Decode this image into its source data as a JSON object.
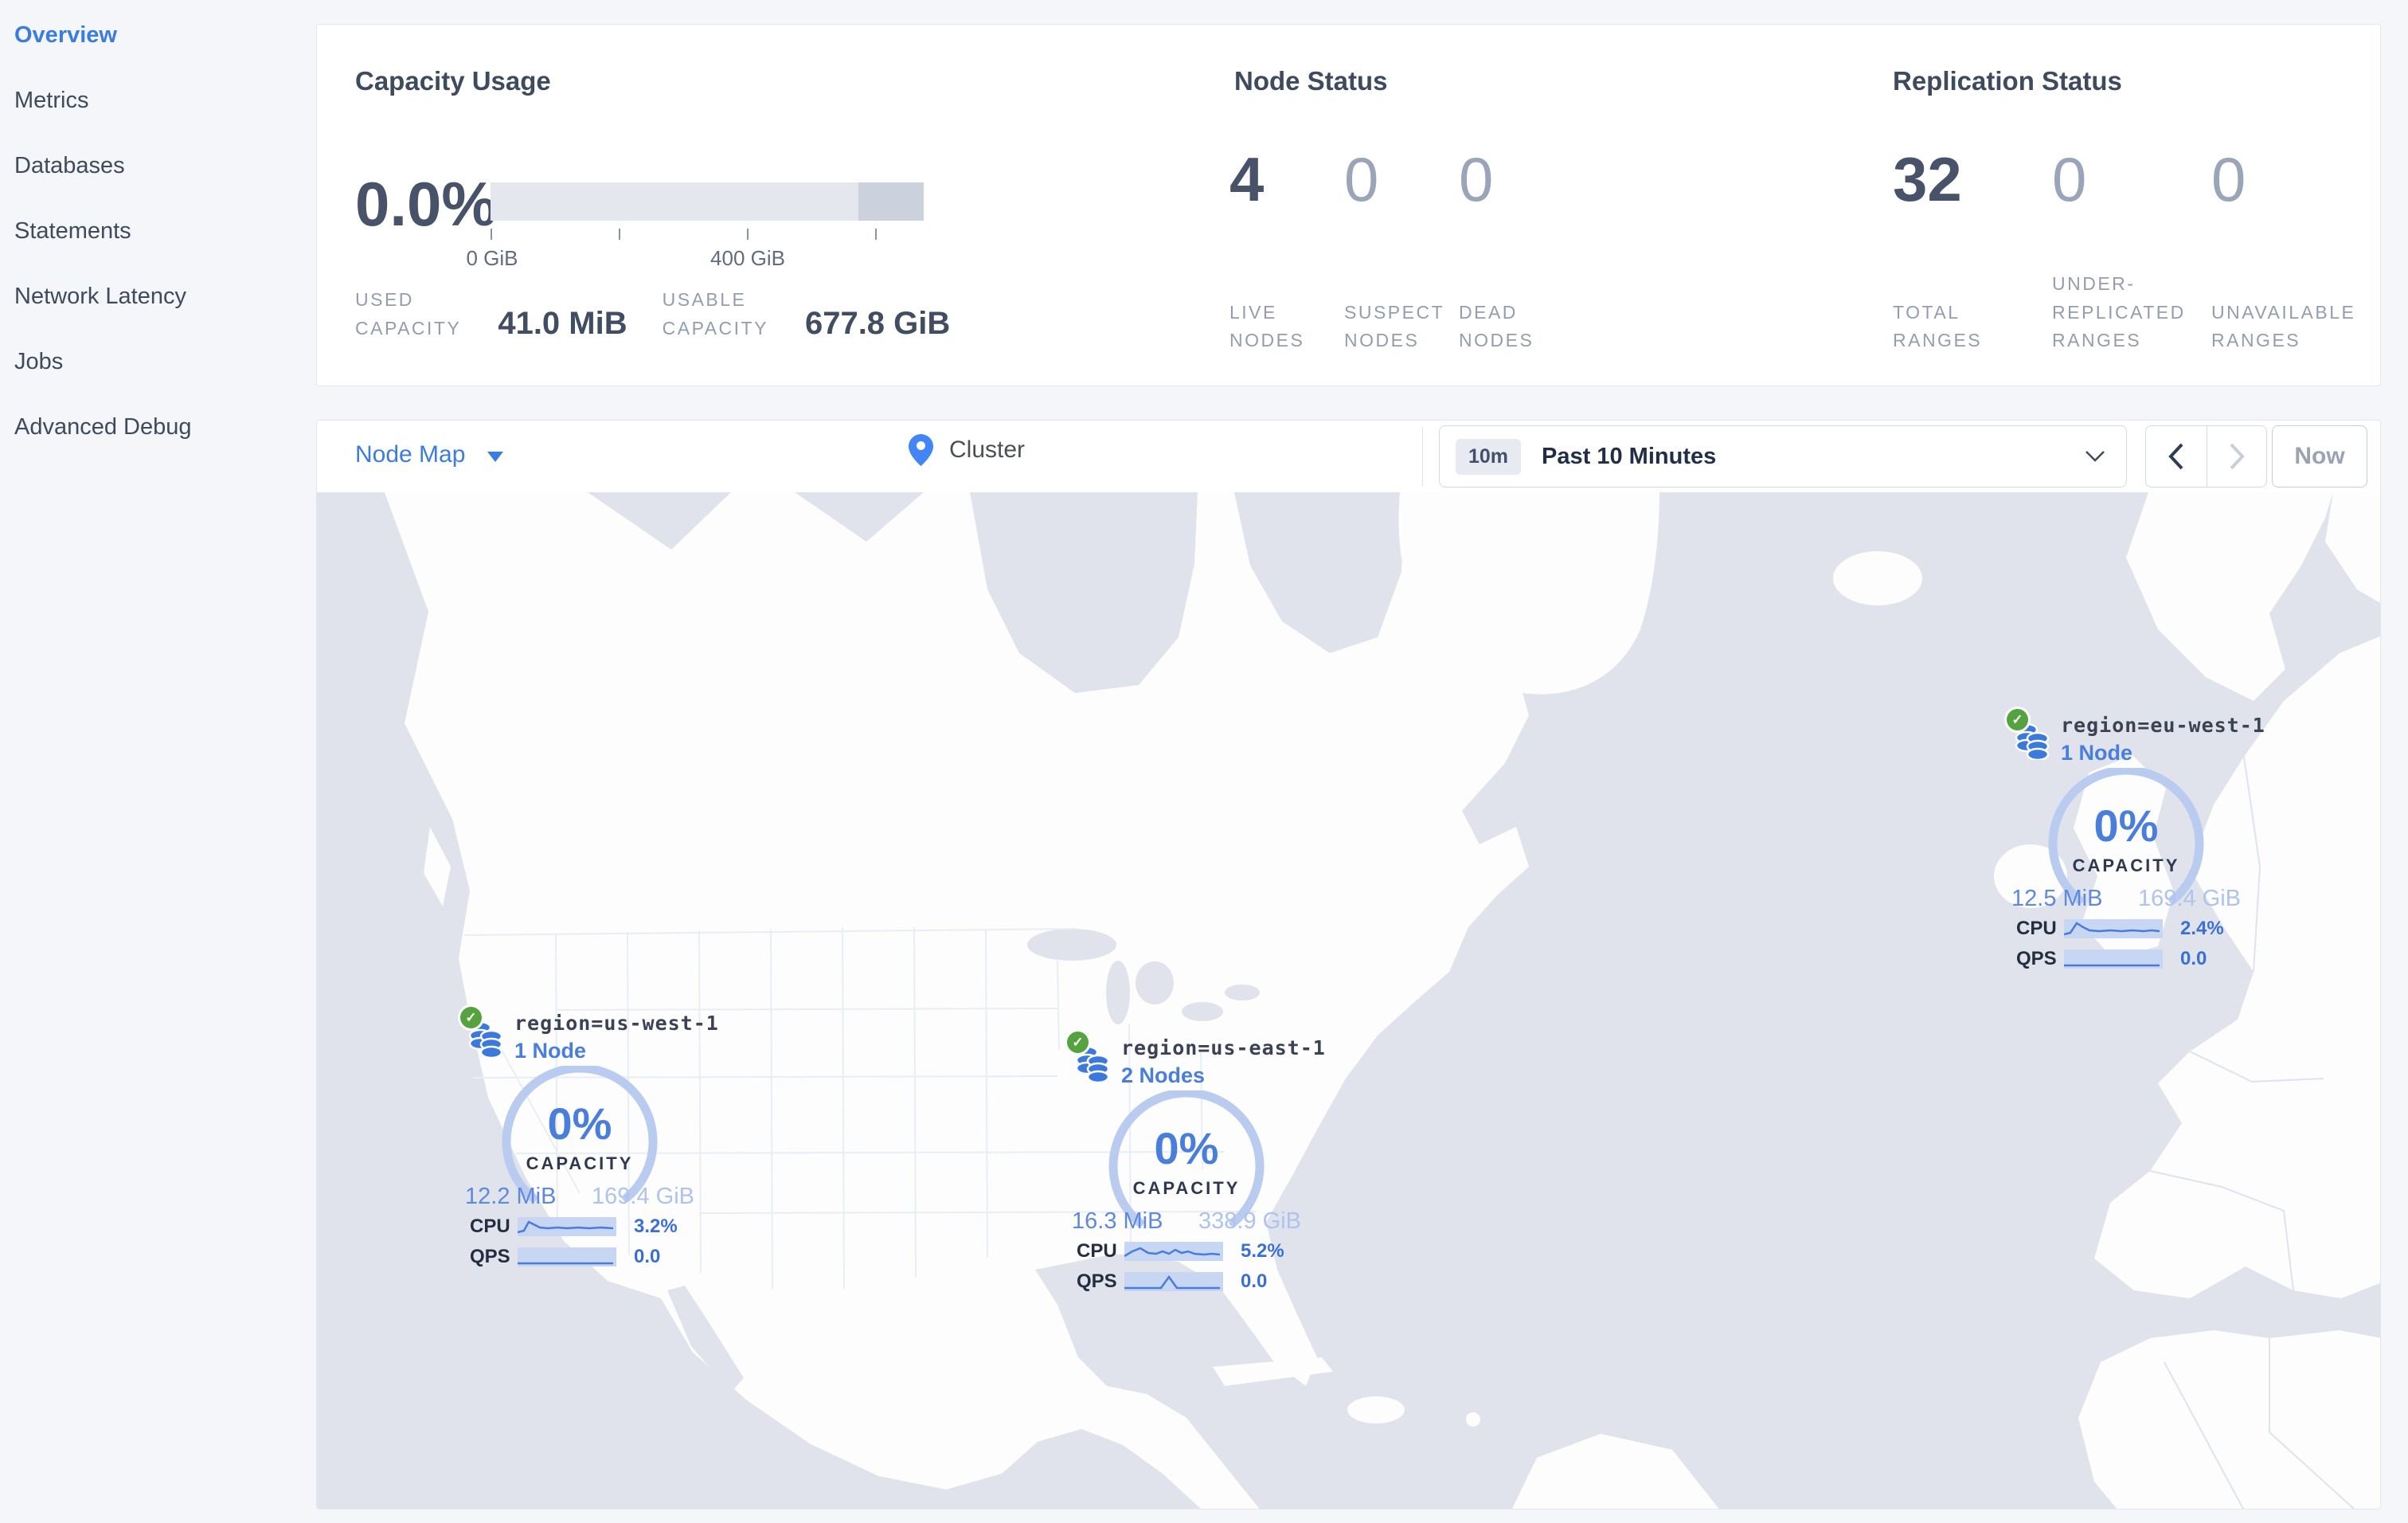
{
  "sidebar": {
    "items": [
      {
        "label": "Overview",
        "active": true
      },
      {
        "label": "Metrics",
        "active": false
      },
      {
        "label": "Databases",
        "active": false
      },
      {
        "label": "Statements",
        "active": false
      },
      {
        "label": "Network Latency",
        "active": false
      },
      {
        "label": "Jobs",
        "active": false
      },
      {
        "label": "Advanced Debug",
        "active": false
      }
    ]
  },
  "summary": {
    "capacity": {
      "title": "Capacity Usage",
      "percent": "0.0%",
      "tick_label_start": "0 GiB",
      "tick_label_mid": "400 GiB",
      "bar": {
        "light_fraction": 0.85,
        "dark_fraction": 0.15
      },
      "stats": [
        {
          "label": "USED\nCAPACITY",
          "value": "41.0 MiB"
        },
        {
          "label": "USABLE\nCAPACITY",
          "value": "677.8 GiB"
        }
      ]
    },
    "nodes": {
      "title": "Node Status",
      "stats": [
        {
          "value": "4",
          "label": "LIVE\nNODES",
          "dim": false
        },
        {
          "value": "0",
          "label": "SUSPECT\nNODES",
          "dim": true
        },
        {
          "value": "0",
          "label": "DEAD\nNODES",
          "dim": true
        }
      ]
    },
    "replication": {
      "title": "Replication Status",
      "stats": [
        {
          "value": "32",
          "label": "TOTAL\nRANGES",
          "dim": false
        },
        {
          "value": "0",
          "label": "UNDER-\nREPLICATED\nRANGES",
          "dim": true
        },
        {
          "value": "0",
          "label": "UNAVAILABLE\nRANGES",
          "dim": true
        }
      ]
    }
  },
  "toolbar": {
    "view_selector": "Node Map",
    "breadcrumb": "Cluster",
    "time_badge": "10m",
    "time_range": "Past 10 Minutes",
    "now_label": "Now"
  },
  "map": {
    "regions": [
      {
        "name": "region=us-west-1",
        "nodes": "1 Node",
        "percent": "0%",
        "capacity_label": "CAPACITY",
        "used": "12.2 MiB",
        "total": "169.4 GiB",
        "cpu_label": "CPU",
        "cpu": "3.2%",
        "qps_label": "QPS",
        "qps": "0.0",
        "cpu_spark": "0,19 8,17 14,6 20,9 28,13 38,14 50,13 62,14 76,13 90,14 104,13 120,14",
        "qps_spark": "0,20 120,20"
      },
      {
        "name": "region=us-east-1",
        "nodes": "2 Nodes",
        "percent": "0%",
        "capacity_label": "CAPACITY",
        "used": "16.3 MiB",
        "total": "338.9 GiB",
        "cpu_label": "CPU",
        "cpu": "5.2%",
        "qps_label": "QPS",
        "qps": "0.0",
        "cpu_spark": "0,18 10,12 20,8 30,14 40,15 48,12 56,15 64,10 72,14 80,12 88,15 100,16 110,15 120,16",
        "qps_spark": "0,20 46,20 56,6 66,20 120,20"
      },
      {
        "name": "region=eu-west-1",
        "nodes": "1 Node",
        "percent": "0%",
        "capacity_label": "CAPACITY",
        "used": "12.5 MiB",
        "total": "169.4 GiB",
        "cpu_label": "CPU",
        "cpu": "2.4%",
        "qps_label": "QPS",
        "qps": "0.0",
        "cpu_spark": "0,19 8,17 16,5 24,10 32,14 44,15 58,14 72,15 86,14 100,15 110,14 120,15",
        "qps_spark": "0,20 120,20"
      }
    ]
  },
  "colors": {
    "accent_blue": "#3a7ce1",
    "gauge_blue": "#4a7edb",
    "check_green": "#55a33e",
    "ocean": "#e0e3eb",
    "land": "#fdfdfe"
  }
}
